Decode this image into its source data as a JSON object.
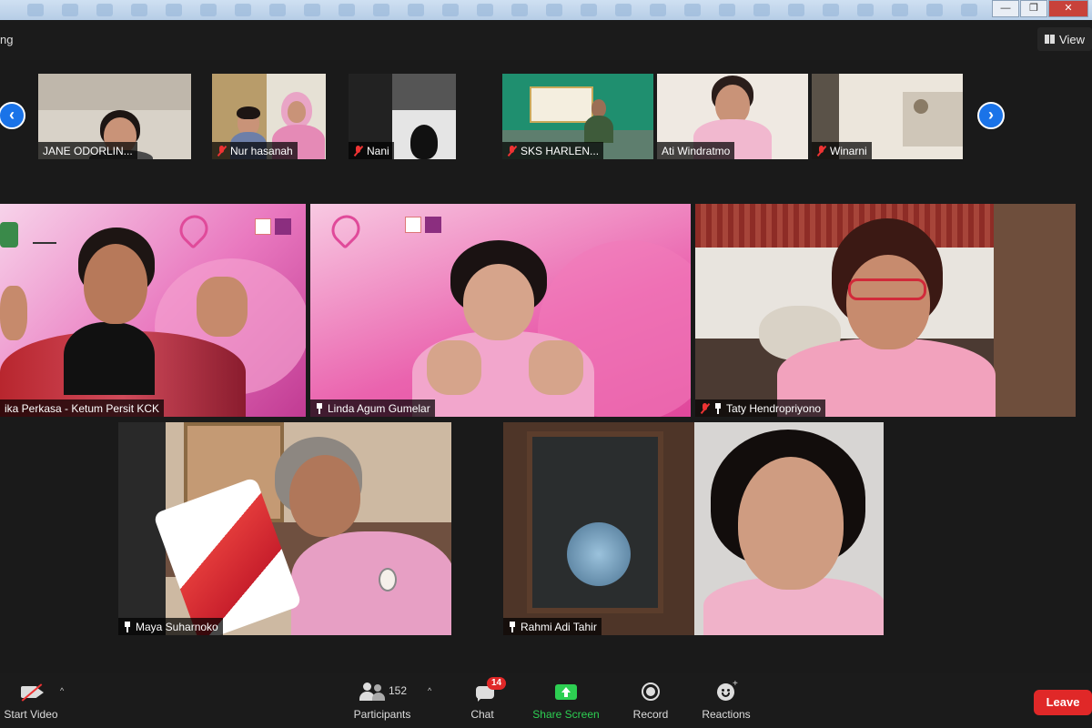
{
  "window": {
    "title_fragment": "ng",
    "view_label": "View",
    "controls": [
      "—",
      "❐",
      "✕"
    ]
  },
  "thumbnails": {
    "prev_arrow": "‹",
    "next_arrow": "›",
    "items": [
      {
        "name": "JANE ODORLIN...",
        "muted": false
      },
      {
        "name": "Nur hasanah",
        "muted": true
      },
      {
        "name": "Nani",
        "muted": true
      },
      {
        "name": "SKS HARLEN...",
        "muted": true
      },
      {
        "name": "Ati Windratmo",
        "muted": false
      },
      {
        "name": "Winarni",
        "muted": true
      }
    ]
  },
  "gallery": [
    {
      "name": "ika Perkasa - Ketum Persit KCK",
      "icon": "none"
    },
    {
      "name": "Linda Agum Gumelar",
      "icon": "pin"
    },
    {
      "name": "Taty Hendropriyono",
      "icon": "mic-off-pin"
    },
    {
      "name": "Maya Suharnoko",
      "icon": "pin"
    },
    {
      "name": "Rahmi Adi Tahir",
      "icon": "pin"
    }
  ],
  "toolbar": {
    "start_video": "Start Video",
    "participants_label": "Participants",
    "participants_count": "152",
    "chat_label": "Chat",
    "chat_badge": "14",
    "share_screen": "Share Screen",
    "record": "Record",
    "reactions": "Reactions",
    "leave": "Leave",
    "caret": "^"
  },
  "colors": {
    "share_green": "#2dcf52",
    "leave_red": "#e02828",
    "arrow_blue": "#1a73e8",
    "pink_background": "#e94aa2"
  }
}
